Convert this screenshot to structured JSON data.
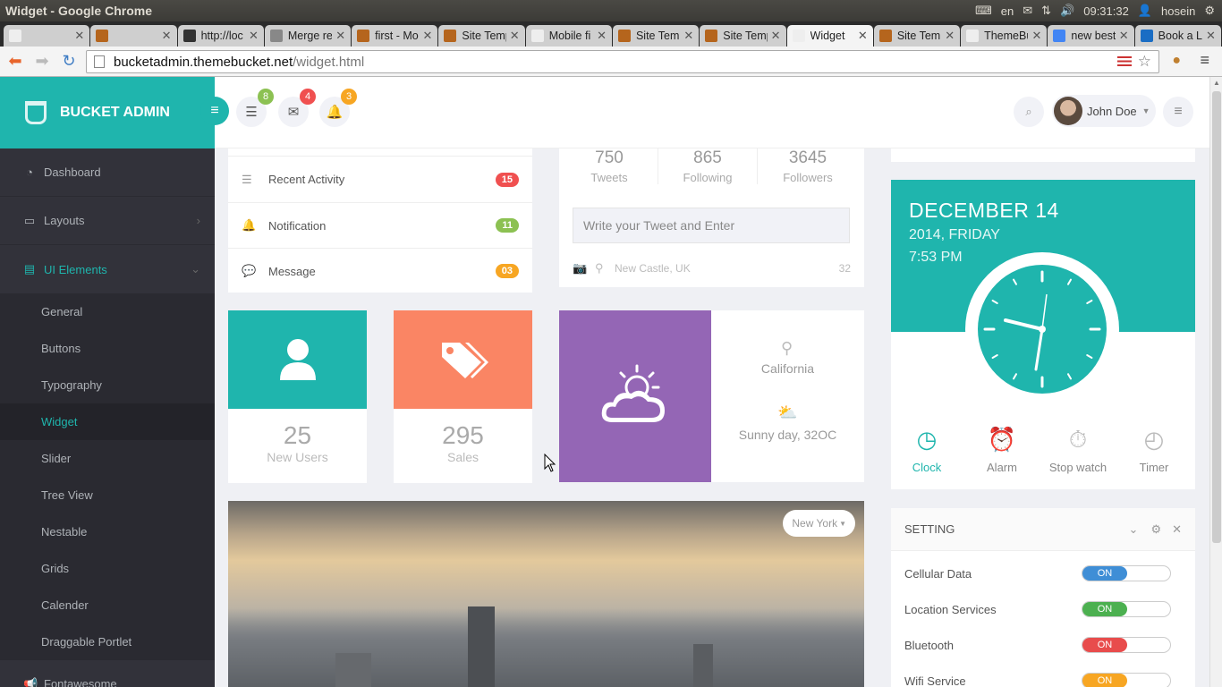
{
  "os": {
    "title": "Widget - Google Chrome",
    "lang": "en",
    "time": "09:31:32",
    "user": "hosein"
  },
  "tabs": [
    {
      "label": "",
      "fav": "#eee",
      "active": false
    },
    {
      "label": "",
      "fav": "#b5651d",
      "active": false
    },
    {
      "label": "http://loc",
      "fav": "#333",
      "active": false
    },
    {
      "label": "Merge re",
      "fav": "#888",
      "active": false
    },
    {
      "label": "first - Mo",
      "fav": "#b5651d",
      "active": false
    },
    {
      "label": "Site Temp",
      "fav": "#b5651d",
      "active": false
    },
    {
      "label": "Mobile fi",
      "fav": "#eee",
      "active": false
    },
    {
      "label": "Site Temp",
      "fav": "#b5651d",
      "active": false
    },
    {
      "label": "Site Temp",
      "fav": "#b5651d",
      "active": false
    },
    {
      "label": "Widget",
      "fav": "#eee",
      "active": true
    },
    {
      "label": "Site Temp",
      "fav": "#b5651d",
      "active": false
    },
    {
      "label": "ThemeBu",
      "fav": "#eee",
      "active": false
    },
    {
      "label": "new best",
      "fav": "#4285f4",
      "active": false
    },
    {
      "label": "Book a Li",
      "fav": "#1a6dc4",
      "active": false
    }
  ],
  "address": {
    "host": "bucketadmin.themebucket.net",
    "path": "/widget.html"
  },
  "brand": {
    "name": "BUCKET ADMIN"
  },
  "nav": {
    "dashboard": "Dashboard",
    "layouts": "Layouts",
    "ui": "UI Elements",
    "fontawesome": "Fontawesome"
  },
  "sub": [
    "General",
    "Buttons",
    "Typography",
    "Widget",
    "Slider",
    "Tree View",
    "Nestable",
    "Grids",
    "Calender",
    "Draggable Portlet"
  ],
  "topnav": {
    "badge1": "8",
    "badge2": "4",
    "badge3": "3",
    "user": "John Doe"
  },
  "activity": [
    {
      "label": "Recent Activity",
      "count": "15",
      "color": "#f05050"
    },
    {
      "label": "Notification",
      "count": "11",
      "color": "#8cc152"
    },
    {
      "label": "Message",
      "count": "03",
      "color": "#f7a623"
    }
  ],
  "twitter": {
    "tweets": "750",
    "tweets_l": "Tweets",
    "following": "865",
    "following_l": "Following",
    "followers": "3645",
    "followers_l": "Followers",
    "placeholder": "Write your Tweet and Enter",
    "location": "New Castle, UK",
    "chars": "32"
  },
  "tiles": {
    "users_n": "25",
    "users_l": "New Users",
    "sales_n": "295",
    "sales_l": "Sales"
  },
  "weather": {
    "city": "California",
    "desc": "Sunny day, 32OC"
  },
  "clock": {
    "date": "DECEMBER 14",
    "day": "2014, FRIDAY",
    "time": "7:53 PM",
    "tabs": [
      "Clock",
      "Alarm",
      "Stop watch",
      "Timer"
    ]
  },
  "photo": {
    "city": "New York"
  },
  "setting": {
    "title": "SETTING",
    "rows": [
      {
        "label": "Cellular Data",
        "state": "ON",
        "color": "#3f8ed6"
      },
      {
        "label": "Location Services",
        "state": "ON",
        "color": "#4cb050"
      },
      {
        "label": "Bluetooth",
        "state": "ON",
        "color": "#e84c4c"
      },
      {
        "label": "Wifi Service",
        "state": "ON",
        "color": "#f7a623"
      }
    ]
  }
}
